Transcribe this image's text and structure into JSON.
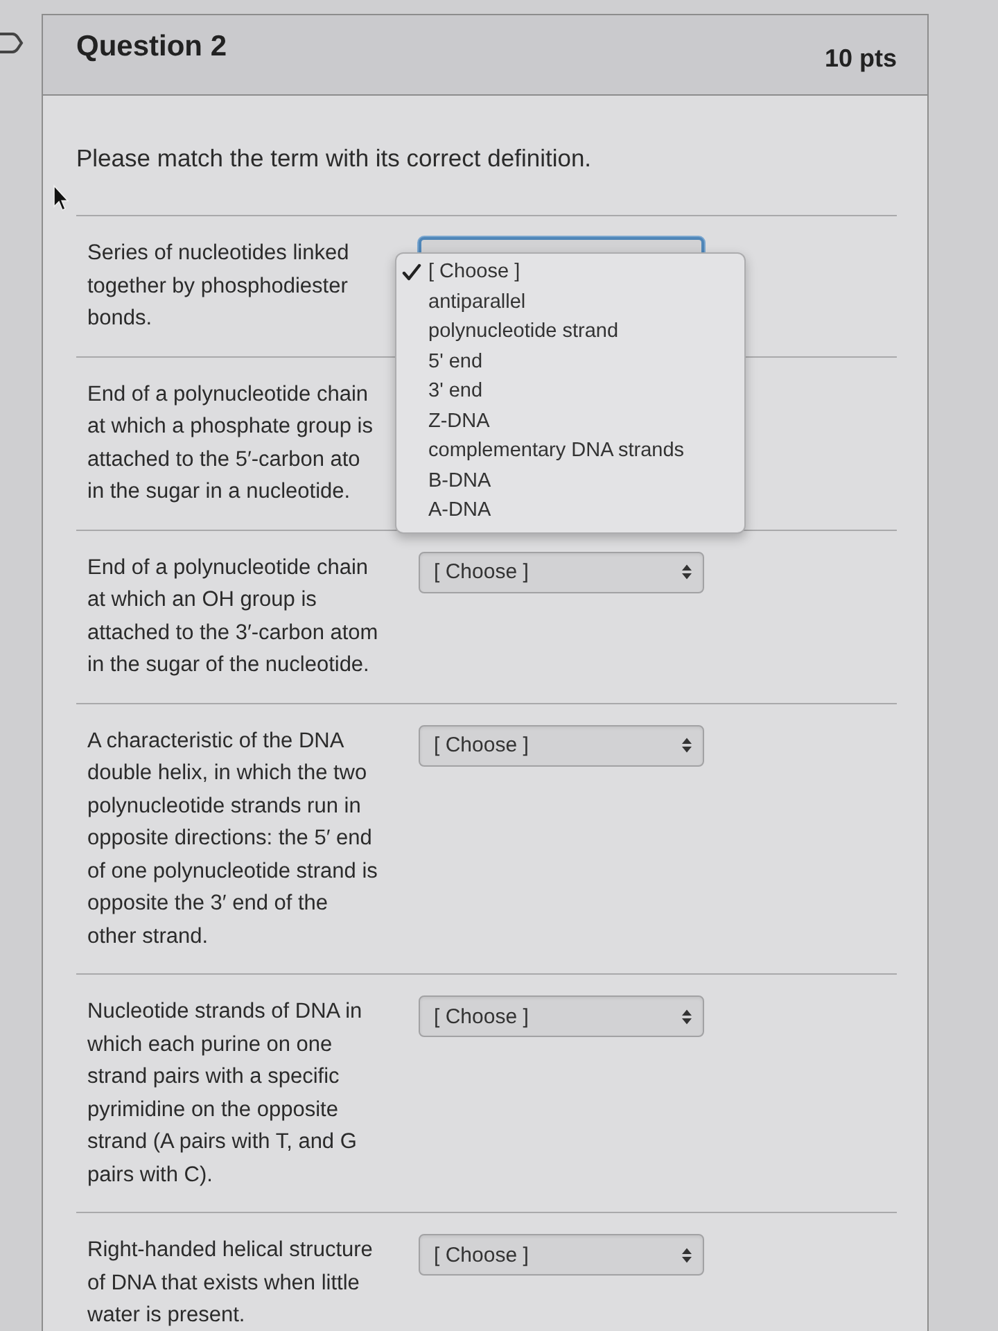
{
  "question": {
    "title": "Question 2",
    "points": "10 pts",
    "prompt": "Please match the term with its correct definition."
  },
  "items": [
    {
      "definition_lines": [
        "Series of nucleotides linked",
        "together by phosphodiester",
        "bonds."
      ],
      "select": {
        "open": true,
        "options": [
          {
            "label": "[ Choose ]",
            "selected": true
          },
          {
            "label": "antiparallel",
            "selected": false
          },
          {
            "label": "polynucleotide strand",
            "selected": false
          },
          {
            "label": "5' end",
            "selected": false
          },
          {
            "label": "3' end",
            "selected": false
          },
          {
            "label": "Z-DNA",
            "selected": false
          },
          {
            "label": "complementary DNA strands",
            "selected": false
          },
          {
            "label": "B-DNA",
            "selected": false
          },
          {
            "label": "A-DNA",
            "selected": false
          }
        ]
      }
    },
    {
      "definition_lines": [
        "End of a polynucleotide chain",
        "at which a phosphate group is",
        "attached to the 5′-carbon ato",
        "in the sugar in a nucleotide."
      ]
    },
    {
      "definition_lines": [
        "End of a polynucleotide chain",
        "at which an OH group is",
        "attached to the 3′-carbon atom",
        "in the sugar of the nucleotide."
      ],
      "select": {
        "open": false,
        "value": "[ Choose ]"
      }
    },
    {
      "definition_lines": [
        "A characteristic of the DNA",
        "double helix, in which the two",
        "polynucleotide strands run in",
        "opposite directions: the 5′ end",
        "of one polynucleotide strand is",
        "opposite the 3′ end of the",
        "other strand."
      ],
      "select": {
        "open": false,
        "value": "[ Choose ]"
      }
    },
    {
      "definition_lines": [
        "Nucleotide strands of DNA in",
        "which each purine on one",
        "strand pairs with a specific",
        "pyrimidine on the opposite",
        "strand (A pairs with T, and G",
        "pairs with C)."
      ],
      "select": {
        "open": false,
        "value": "[ Choose ]"
      }
    },
    {
      "definition_lines": [
        "Right-handed helical structure",
        "of DNA that exists when little",
        "water is present."
      ],
      "select": {
        "open": false,
        "value": "[ Choose ]"
      }
    }
  ]
}
